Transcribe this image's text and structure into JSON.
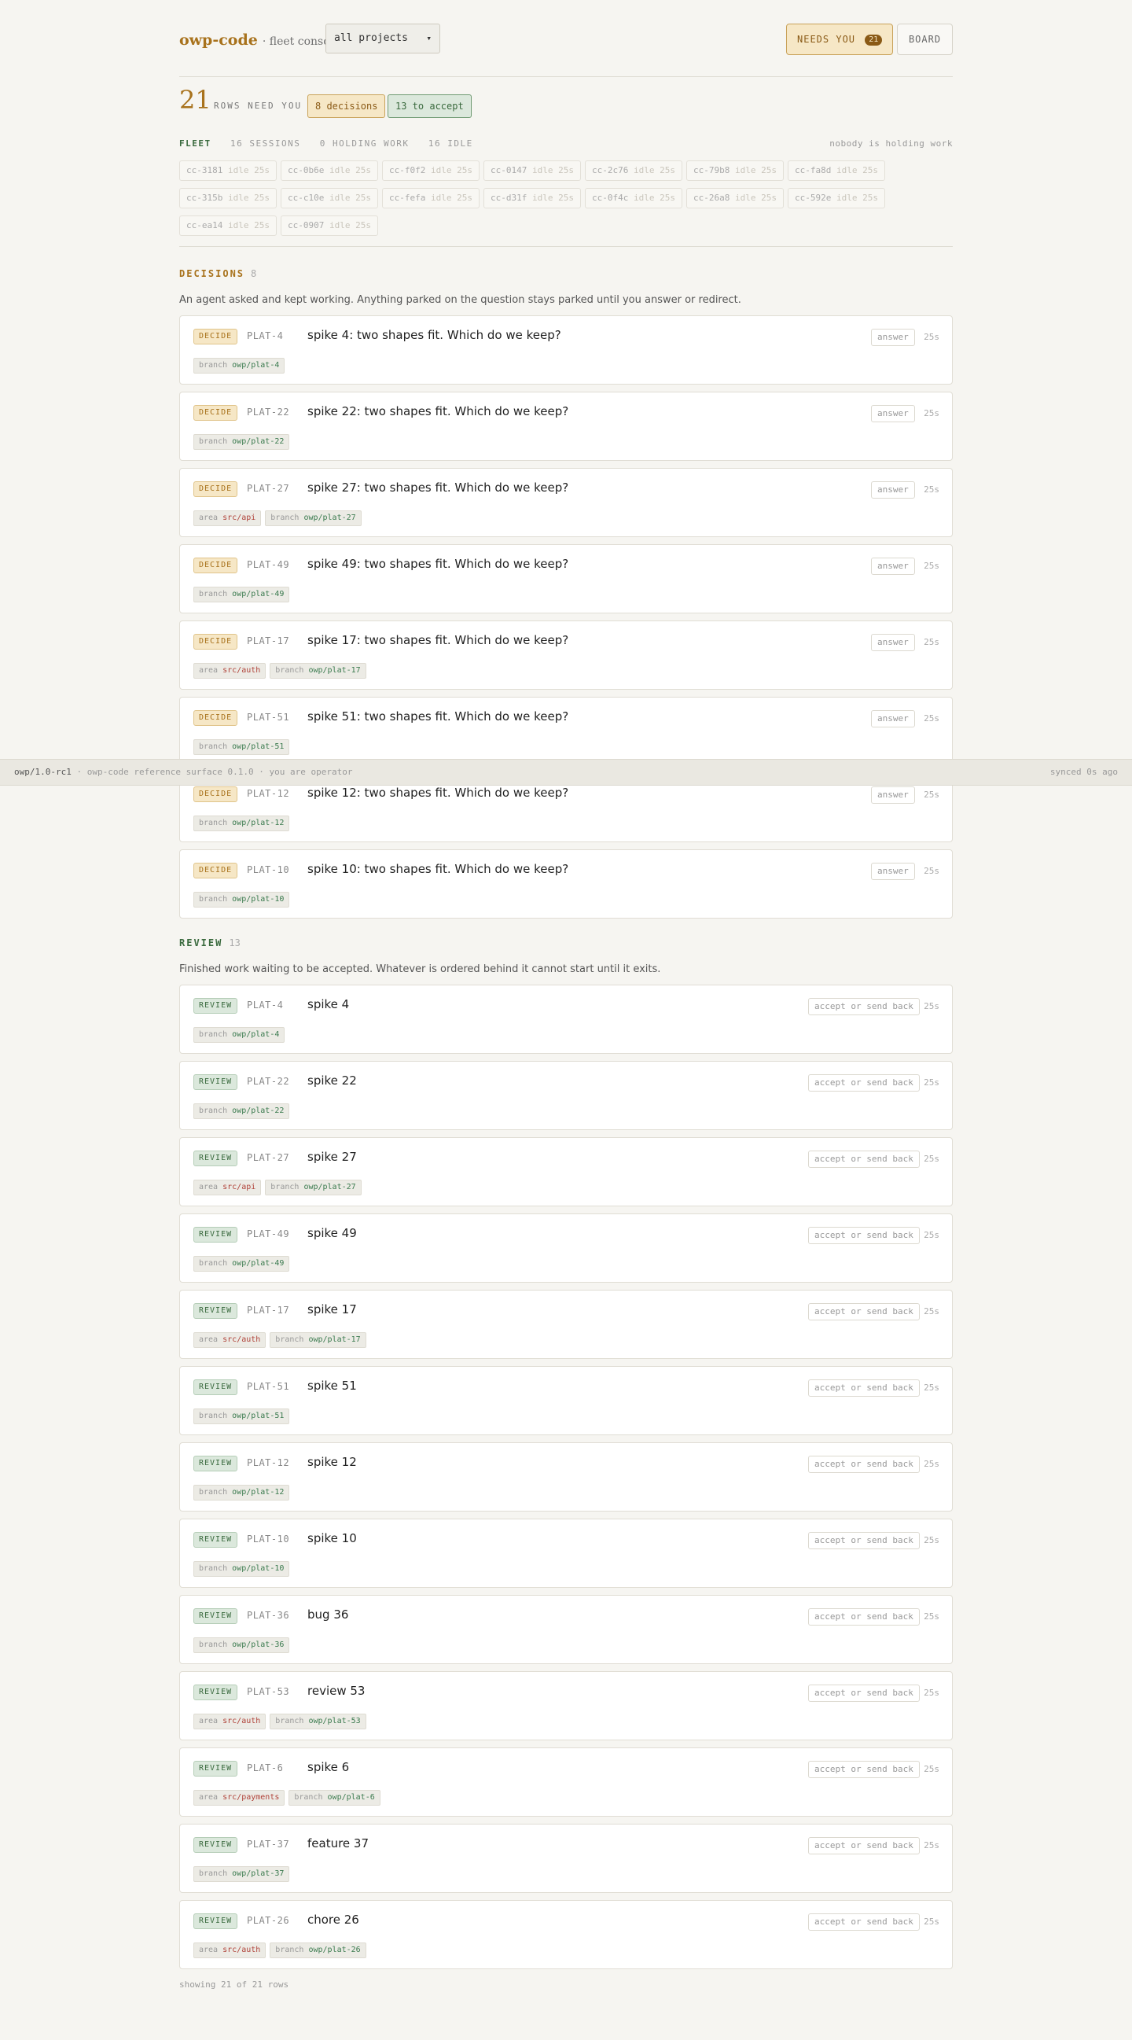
{
  "header": {
    "brand": "owp-code",
    "subtitle": "· fleet console",
    "project_select": "all projects",
    "needs_you_label": "NEEDS YOU",
    "needs_you_count": "21",
    "board_label": "BOARD"
  },
  "summary": {
    "count": "21",
    "label": "ROWS NEED YOU",
    "decisions_pill": "8 decisions",
    "accept_pill": "13 to accept"
  },
  "fleet": {
    "title": "FLEET",
    "sessions": "16 SESSIONS",
    "holding": "0 HOLDING WORK",
    "idle": "16 IDLE",
    "note": "nobody is holding work",
    "chips": [
      {
        "id": "cc-3181",
        "state": "idle 25s"
      },
      {
        "id": "cc-0b6e",
        "state": "idle 25s"
      },
      {
        "id": "cc-f0f2",
        "state": "idle 25s"
      },
      {
        "id": "cc-0147",
        "state": "idle 25s"
      },
      {
        "id": "cc-2c76",
        "state": "idle 25s"
      },
      {
        "id": "cc-79b8",
        "state": "idle 25s"
      },
      {
        "id": "cc-fa8d",
        "state": "idle 25s"
      },
      {
        "id": "cc-315b",
        "state": "idle 25s"
      },
      {
        "id": "cc-c10e",
        "state": "idle 25s"
      },
      {
        "id": "cc-fefa",
        "state": "idle 25s"
      },
      {
        "id": "cc-d31f",
        "state": "idle 25s"
      },
      {
        "id": "cc-0f4c",
        "state": "idle 25s"
      },
      {
        "id": "cc-26a8",
        "state": "idle 25s"
      },
      {
        "id": "cc-592e",
        "state": "idle 25s"
      },
      {
        "id": "cc-ea14",
        "state": "idle 25s"
      },
      {
        "id": "cc-0907",
        "state": "idle 25s"
      }
    ]
  },
  "decisions": {
    "title": "DECISIONS",
    "count": "8",
    "description": "An agent asked and kept working. Anything parked on the question stays parked until you answer or redirect.",
    "items": [
      {
        "tag": "DECIDE",
        "id": "PLAT-4",
        "title": "spike 4: two shapes fit. Which do we keep?",
        "action": "answer",
        "age": "25s",
        "area": "",
        "branch": "owp/plat-4"
      },
      {
        "tag": "DECIDE",
        "id": "PLAT-22",
        "title": "spike 22: two shapes fit. Which do we keep?",
        "action": "answer",
        "age": "25s",
        "area": "",
        "branch": "owp/plat-22"
      },
      {
        "tag": "DECIDE",
        "id": "PLAT-27",
        "title": "spike 27: two shapes fit. Which do we keep?",
        "action": "answer",
        "age": "25s",
        "area": "src/api",
        "branch": "owp/plat-27"
      },
      {
        "tag": "DECIDE",
        "id": "PLAT-49",
        "title": "spike 49: two shapes fit. Which do we keep?",
        "action": "answer",
        "age": "25s",
        "area": "",
        "branch": "owp/plat-49"
      },
      {
        "tag": "DECIDE",
        "id": "PLAT-17",
        "title": "spike 17: two shapes fit. Which do we keep?",
        "action": "answer",
        "age": "25s",
        "area": "src/auth",
        "branch": "owp/plat-17"
      },
      {
        "tag": "DECIDE",
        "id": "PLAT-51",
        "title": "spike 51: two shapes fit. Which do we keep?",
        "action": "answer",
        "age": "25s",
        "area": "",
        "branch": "owp/plat-51"
      },
      {
        "tag": "DECIDE",
        "id": "PLAT-12",
        "title": "spike 12: two shapes fit. Which do we keep?",
        "action": "answer",
        "age": "25s",
        "area": "",
        "branch": "owp/plat-12"
      },
      {
        "tag": "DECIDE",
        "id": "PLAT-10",
        "title": "spike 10: two shapes fit. Which do we keep?",
        "action": "answer",
        "age": "25s",
        "area": "",
        "branch": "owp/plat-10"
      }
    ]
  },
  "review": {
    "title": "REVIEW",
    "count": "13",
    "description": "Finished work waiting to be accepted. Whatever is ordered behind it cannot start until it exits.",
    "items": [
      {
        "tag": "REVIEW",
        "id": "PLAT-4",
        "title": "spike 4",
        "action": "accept or send back",
        "age": "25s",
        "area": "",
        "branch": "owp/plat-4"
      },
      {
        "tag": "REVIEW",
        "id": "PLAT-22",
        "title": "spike 22",
        "action": "accept or send back",
        "age": "25s",
        "area": "",
        "branch": "owp/plat-22"
      },
      {
        "tag": "REVIEW",
        "id": "PLAT-27",
        "title": "spike 27",
        "action": "accept or send back",
        "age": "25s",
        "area": "src/api",
        "branch": "owp/plat-27"
      },
      {
        "tag": "REVIEW",
        "id": "PLAT-49",
        "title": "spike 49",
        "action": "accept or send back",
        "age": "25s",
        "area": "",
        "branch": "owp/plat-49"
      },
      {
        "tag": "REVIEW",
        "id": "PLAT-17",
        "title": "spike 17",
        "action": "accept or send back",
        "age": "25s",
        "area": "src/auth",
        "branch": "owp/plat-17"
      },
      {
        "tag": "REVIEW",
        "id": "PLAT-51",
        "title": "spike 51",
        "action": "accept or send back",
        "age": "25s",
        "area": "",
        "branch": "owp/plat-51"
      },
      {
        "tag": "REVIEW",
        "id": "PLAT-12",
        "title": "spike 12",
        "action": "accept or send back",
        "age": "25s",
        "area": "",
        "branch": "owp/plat-12"
      },
      {
        "tag": "REVIEW",
        "id": "PLAT-10",
        "title": "spike 10",
        "action": "accept or send back",
        "age": "25s",
        "area": "",
        "branch": "owp/plat-10"
      },
      {
        "tag": "REVIEW",
        "id": "PLAT-36",
        "title": "bug 36",
        "action": "accept or send back",
        "age": "25s",
        "area": "",
        "branch": "owp/plat-36"
      },
      {
        "tag": "REVIEW",
        "id": "PLAT-53",
        "title": "review 53",
        "action": "accept or send back",
        "age": "25s",
        "area": "src/auth",
        "branch": "owp/plat-53"
      },
      {
        "tag": "REVIEW",
        "id": "PLAT-6",
        "title": "spike 6",
        "action": "accept or send back",
        "age": "25s",
        "area": "src/payments",
        "branch": "owp/plat-6"
      },
      {
        "tag": "REVIEW",
        "id": "PLAT-37",
        "title": "feature 37",
        "action": "accept or send back",
        "age": "25s",
        "area": "",
        "branch": "owp/plat-37"
      },
      {
        "tag": "REVIEW",
        "id": "PLAT-26",
        "title": "chore 26",
        "action": "accept or send back",
        "age": "25s",
        "area": "src/auth",
        "branch": "owp/plat-26"
      }
    ]
  },
  "labels": {
    "area": "area",
    "branch": "branch"
  },
  "footer": {
    "showing": "showing 21 of 21 rows"
  },
  "statusbar": {
    "version": "owp/1.0-rc1",
    "sep": "·",
    "surface": "owp-code reference surface 0.1.0",
    "role": "you are operator",
    "synced": "synced 0s ago"
  },
  "colors": {
    "accent": "#a8721c",
    "review_green": "#3a6a3e",
    "background": "#f6f5f1"
  }
}
